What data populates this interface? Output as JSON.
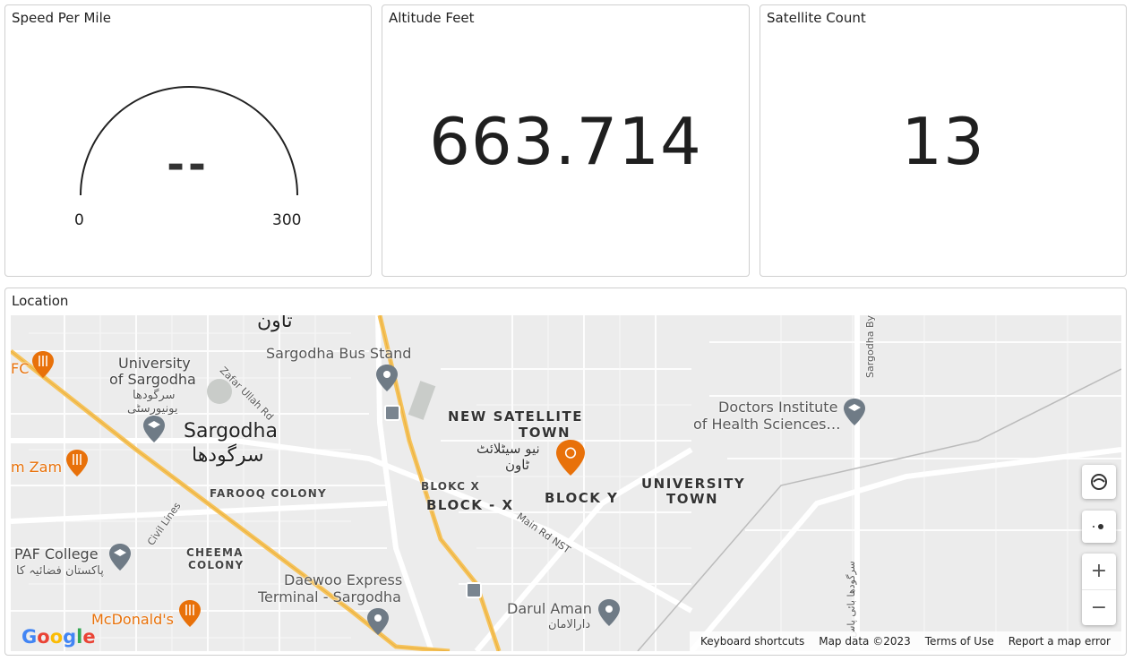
{
  "cards": {
    "speed": {
      "title": "Speed Per Mile",
      "value": "--",
      "min": "0",
      "max": "300"
    },
    "altitude": {
      "title": "Altitude Feet",
      "value": "663.714"
    },
    "satellites": {
      "title": "Satellite Count",
      "value": "13"
    }
  },
  "location": {
    "title": "Location",
    "map": {
      "labels": {
        "town_urdu_top": "تاون",
        "bus_stand": "Sargodha Bus Stand",
        "kfc": "FC",
        "university_line1": "University",
        "university_line2": "of Sargodha",
        "university_urdu1": "سرگودھا",
        "university_urdu2": "یونیورسٹی",
        "zafar_road": "Zafar Ullah Rd",
        "sargodha": "Sargodha",
        "sargodha_urdu": "سرگودھا",
        "new_sat_line1": "NEW SATELLITE",
        "new_sat_line2": "TOWN",
        "new_sat_urdu1": "نیو سیٹلائٹ",
        "new_sat_urdu2": "ٹاون",
        "doctors_line1": "Doctors Institute",
        "doctors_line2": "of Health Sciences…",
        "sargodha_bypass": "Sargodha Byp",
        "zam_zam": "m Zam",
        "farooq": "FAROOQ COLONY",
        "blokc": "BLOKC X",
        "block_x": "BLOCK - X",
        "block_y": "BLOCK Y",
        "univ_town1": "UNIVERSITY",
        "univ_town2": "TOWN",
        "civil_lines": "Civil Lines",
        "main_rd": "Main Rd NST",
        "paf_line1": "PAF College",
        "paf_urdu": "پاکستان فضائیہ کا",
        "cheema1": "CHEEMA",
        "cheema2": "COLONY",
        "daewoo1": "Daewoo Express",
        "daewoo2": "Terminal - Sargodha",
        "darul": "Darul Aman",
        "darul_urdu": "دارالامان",
        "mcdonalds": "McDonald's",
        "bypass_urdu": "سرگودھا بائی پاس"
      },
      "controls": {
        "zoom_in": "+",
        "zoom_out": "−"
      },
      "footer": {
        "keyboard": "Keyboard shortcuts",
        "map_data": "Map data ©2023",
        "terms": "Terms of Use",
        "report": "Report a map error"
      },
      "logo": {
        "g1": "G",
        "o1": "o",
        "o2": "o",
        "g2": "g",
        "l": "l",
        "e": "e"
      }
    }
  },
  "colors": {
    "pin": "#e8710a",
    "poi_pin": "#6f7b86",
    "highway": "#f6c35b"
  }
}
